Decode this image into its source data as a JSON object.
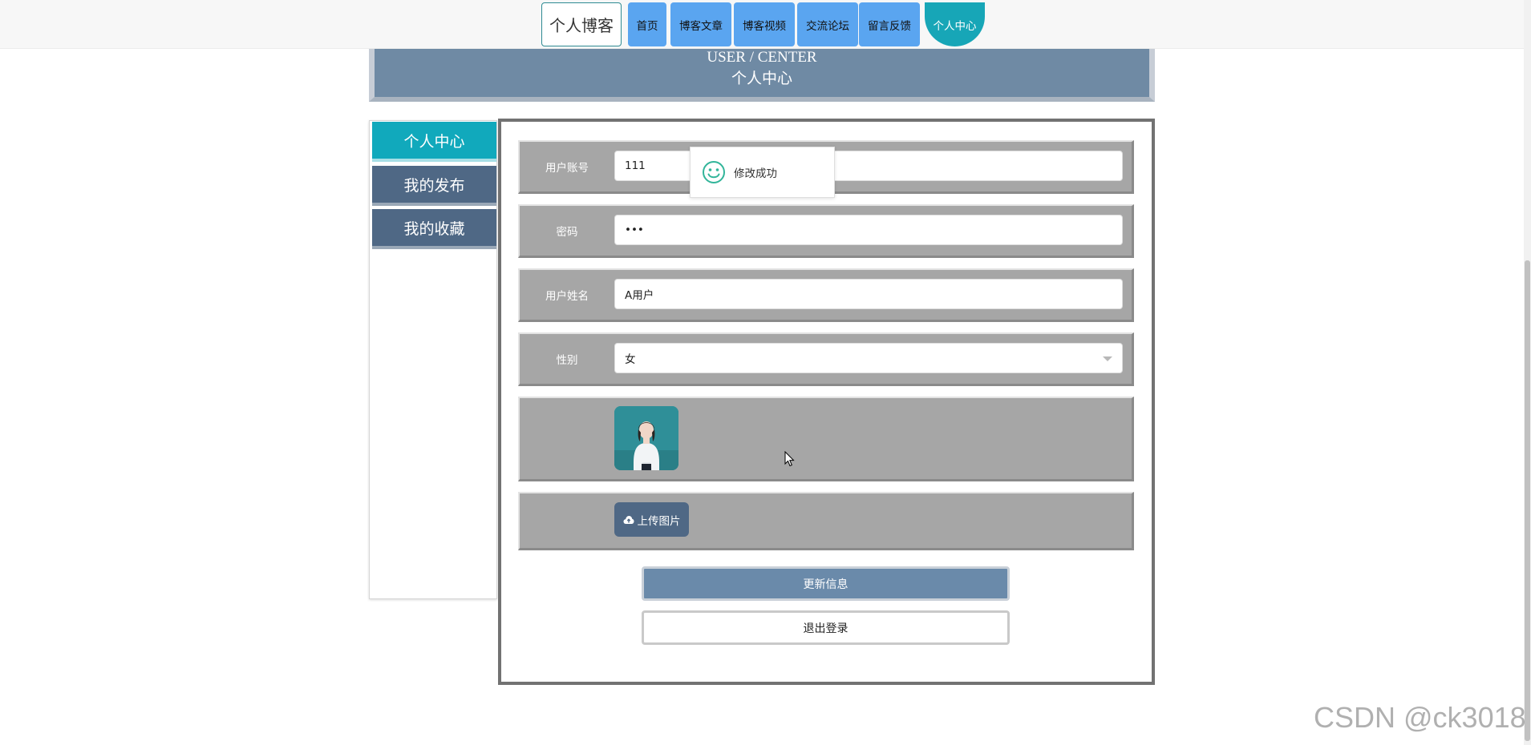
{
  "nav": {
    "brand": "个人博客",
    "items": [
      "首页",
      "博客文章",
      "博客视频",
      "交流论坛",
      "留言反馈"
    ],
    "active": "个人中心"
  },
  "banner": {
    "title_en": "USER / CENTER",
    "title_zh": "个人中心"
  },
  "sidebar": {
    "items": [
      {
        "label": "个人中心",
        "active": true
      },
      {
        "label": "我的发布",
        "active": false
      },
      {
        "label": "我的收藏",
        "active": false
      }
    ]
  },
  "form": {
    "account": {
      "label": "用户账号",
      "value": "111"
    },
    "password": {
      "label": "密码",
      "value": "***"
    },
    "name": {
      "label": "用户姓名",
      "value": "A用户"
    },
    "gender": {
      "label": "性别",
      "value": "女"
    },
    "upload_label": "上传图片",
    "update_label": "更新信息",
    "logout_label": "退出登录"
  },
  "toast": {
    "message": "修改成功",
    "icon": "smile-icon"
  },
  "watermark": "CSDN @ck3018",
  "colors": {
    "nav_button": "#5aa5f0",
    "nav_active": "#17a6b7",
    "banner": "#6f8aa4",
    "sidebar_active": "#11a9bc",
    "sidebar_normal": "#4f6885",
    "row_bg": "#a6a6a6",
    "update_button": "#6a8aaa"
  }
}
